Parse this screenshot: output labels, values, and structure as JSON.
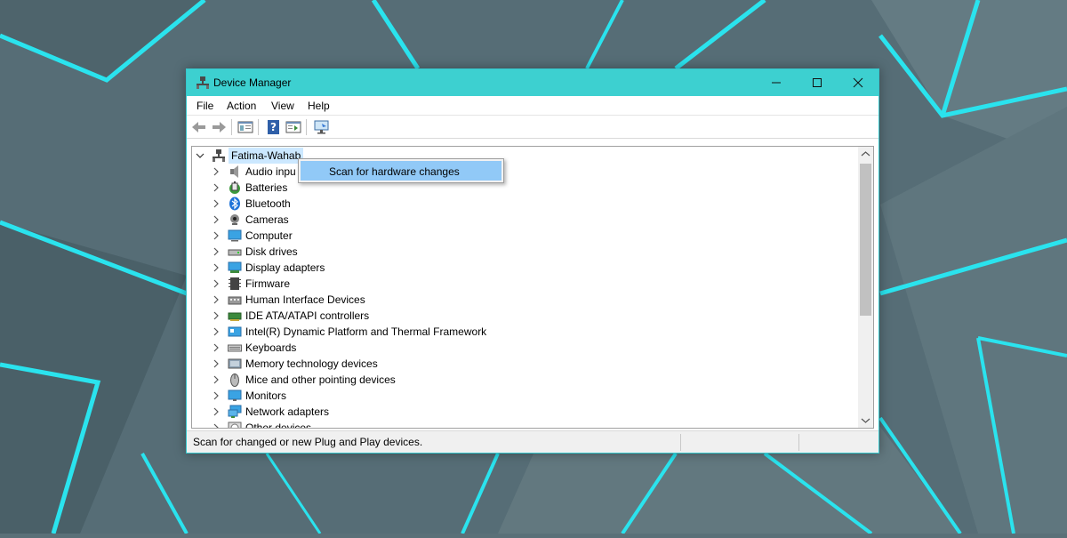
{
  "window": {
    "title": "Device Manager",
    "controls": {
      "minimize": "minimize",
      "maximize": "maximize",
      "close": "close"
    }
  },
  "menu": {
    "items": [
      "File",
      "Action",
      "View",
      "Help"
    ]
  },
  "toolbar": {
    "icons": [
      "back-icon",
      "forward-icon",
      "show-hide-console-tree-icon",
      "help-icon",
      "action-pane-icon",
      "scan-hardware-icon"
    ]
  },
  "tree": {
    "root": "Fatima-Wahab",
    "categories": [
      "Audio inpu",
      "Batteries",
      "Bluetooth",
      "Cameras",
      "Computer",
      "Disk drives",
      "Display adapters",
      "Firmware",
      "Human Interface Devices",
      "IDE ATA/ATAPI controllers",
      "Intel(R) Dynamic Platform and Thermal Framework",
      "Keyboards",
      "Memory technology devices",
      "Mice and other pointing devices",
      "Monitors",
      "Network adapters",
      "Other devices"
    ]
  },
  "context_menu": {
    "item": "Scan for hardware changes"
  },
  "status": {
    "text": "Scan for changed or new Plug and Play devices."
  },
  "colors": {
    "titlebar": "#3dd0d0",
    "selection": "#cce8ff",
    "menu_highlight": "#91c9f7",
    "desktop_accent": "#28e6f0"
  }
}
